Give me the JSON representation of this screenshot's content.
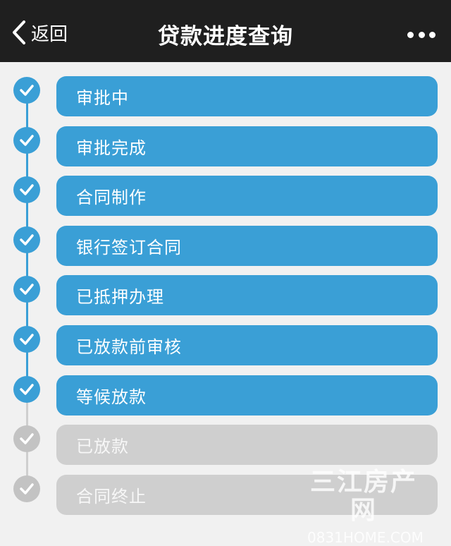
{
  "header": {
    "back_label": "返回",
    "title": "贷款进度查询",
    "more_icon": "more-dots-icon"
  },
  "colors": {
    "active": "#3a9fd6",
    "inactive": "#cfcfcf",
    "dot_inactive": "#c3c3c3",
    "text_active": "#ffffff",
    "text_inactive": "#f7f7f7"
  },
  "steps": [
    {
      "label": "审批中",
      "completed": true
    },
    {
      "label": "审批完成",
      "completed": true
    },
    {
      "label": "合同制作",
      "completed": true
    },
    {
      "label": "银行签订合同",
      "completed": true
    },
    {
      "label": "已抵押办理",
      "completed": true
    },
    {
      "label": "已放款前审核",
      "completed": true
    },
    {
      "label": "等候放款",
      "completed": true
    },
    {
      "label": "已放款",
      "completed": false
    },
    {
      "label": "合同终止",
      "completed": false
    }
  ],
  "watermark": {
    "name": "三江房产网",
    "domain": "0831HOME.COM"
  }
}
